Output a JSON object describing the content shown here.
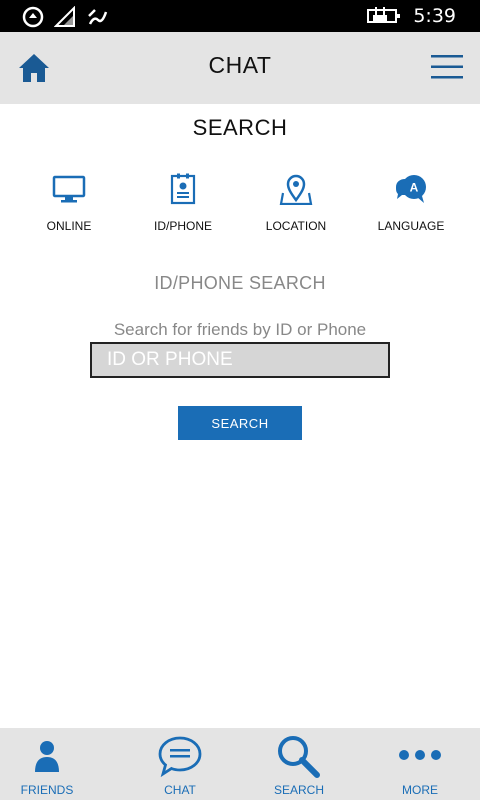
{
  "status_bar": {
    "time": "5:39"
  },
  "header": {
    "title": "CHAT"
  },
  "page": {
    "title": "SEARCH"
  },
  "categories": [
    {
      "label": "ONLINE",
      "icon": "monitor-icon"
    },
    {
      "label": "ID/PHONE",
      "icon": "id-card-icon"
    },
    {
      "label": "LOCATION",
      "icon": "location-pin-icon"
    },
    {
      "label": "LANGUAGE",
      "icon": "language-bubble-icon",
      "badge": "A"
    }
  ],
  "id_search": {
    "title": "ID/PHONE SEARCH",
    "hint": "Search for friends by ID or Phone",
    "placeholder": "ID OR PHONE",
    "button": "SEARCH"
  },
  "bottom_nav": [
    {
      "label": "FRIENDS",
      "icon": "person-icon"
    },
    {
      "label": "CHAT",
      "icon": "chat-bubble-icon"
    },
    {
      "label": "SEARCH",
      "icon": "magnifier-icon"
    },
    {
      "label": "MORE",
      "icon": "ellipsis-icon"
    }
  ],
  "colors": {
    "accent": "#1a6db6",
    "bar_bg": "#e4e4e4",
    "status_bg": "#000000"
  }
}
